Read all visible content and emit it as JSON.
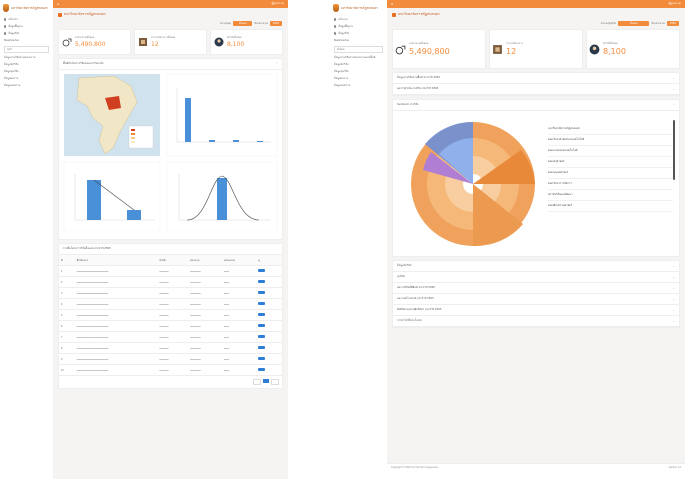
{
  "screens": {
    "left": {
      "sidebar": {
        "brand": "มหาวิทยาลัยราชภัฏสกลนคร",
        "items": [
          "หน้าแรก",
          "ข้อมูลพื้นฐาน",
          "ข้อมูลวิจัย"
        ],
        "filter_label": "ปีงบประมาณ",
        "filter_value": "ทุกปี",
        "menu": [
          "ข้อมูลงานวิจัยตามหน่วยงาน",
          "ข้อมูลนักวิจัย",
          "ข้อมูลทุนวิจัย",
          "ข้อมูลผลงาน",
          "ข้อมูลบทความ"
        ]
      },
      "topbar": {
        "user": "ผู้ดูแลระบบ"
      },
      "page_title": "มหาวิทยาลัยราชภัฏสกลนคร",
      "filters": {
        "label_1": "ประเภททุน",
        "value_1": "ทั้งหมด",
        "label_2": "ปีงบประมาณ",
        "value_2": "2565"
      },
      "stats": [
        {
          "icon": "money-icon",
          "label": "งบประมาณทั้งหมด",
          "value": "5,490,800"
        },
        {
          "icon": "map-icon",
          "label": "จำนวนโครงการทั้งหมด",
          "value": "12"
        },
        {
          "icon": "avatar-icon",
          "label": "นักวิจัยทั้งหมด",
          "value": "8,100"
        }
      ],
      "map_panel_title": "พื้นที่ดำเนินการวิจัยของมหาวิทยาลัย",
      "table_title": "รายชื่อโครงการวิจัยทั้งหมด ประจำปี 2565",
      "table_columns": [
        "#",
        "ชื่อโครงการ",
        "หัวหน้า",
        "หน่วยงาน",
        "งบประมาณ",
        "ดู"
      ]
    },
    "right": {
      "sidebar": {
        "brand": "มหาวิทยาลัยราชภัฏสกลนคร",
        "items": [
          "หน้าแรก",
          "ข้อมูลพื้นฐาน",
          "ข้อมูลวิจัย"
        ],
        "filter_label": "ปีงบประมาณ",
        "filter_value": "ทั้งหมด",
        "menu": [
          "ข้อมูลงานวิจัยตามหน่วยงานและพื้นที่",
          "ข้อมูลนักวิจัย",
          "ข้อมูลทุนวิจัย",
          "ข้อมูลผลงาน",
          "ข้อมูลบทความ"
        ]
      },
      "topbar": {
        "user": "ผู้ดูแลระบบ"
      },
      "page_title": "มหาวิทยาลัยราชภัฏสกลนคร",
      "filters": {
        "label_1": "ประเภททุนวิจัย",
        "value_1": "ทั้งหมด",
        "label_2": "ปีงบประมาณ",
        "value_2": "2565"
      },
      "stats": [
        {
          "icon": "money-icon",
          "label": "งบประมาณทั้งหมด",
          "value": "5,490,800"
        },
        {
          "icon": "map-icon",
          "label": "จำนวนโครงการ",
          "value": "12"
        },
        {
          "icon": "avatar-icon",
          "label": "นักวิจัยทั้งหมด",
          "value": "8,100"
        }
      ],
      "accordions_top": [
        "ข้อมูลงานวิจัยตามพื้นที่ ประจำปี 2565",
        "ผลการดำเนินงานวิจัย ประจำปี 2565"
      ],
      "sunburst_title": "Sunburst งานวิจัย",
      "legend": [
        "มหาวิทยาลัยราชภัฏสกลนคร",
        "คณะวิทยาศาสตร์และเทคโนโลยี",
        "คณะเกษตรและเทคโนโลยี",
        "คณะครุศาสตร์",
        "คณะมนุษยศาสตร์",
        "คณะวิทยาการจัดการ",
        "สถาบันวิจัยและพัฒนา",
        "คณะศิลปกรรมศาสตร์"
      ],
      "accordions_bottom": [
        "ข้อมูลนักวิจัย",
        "ทุนวิจัย",
        "ผลงานวิจัยที่ตีพิมพ์ ประจำปี 2565",
        "ผลงานสร้างสรรค์ ประจำปี 2565",
        "สิทธิบัตรและอนุสิทธิบัตร ประจำปี 2565",
        "การนำไปใช้ประโยชน์"
      ],
      "footer": {
        "left": "Copyright © 2022 มหาวิทยาลัยราชภัฏสกลนคร",
        "right": "Version 1.0"
      }
    }
  },
  "colors": {
    "accent": "#f28c3c",
    "dark_accent": "#c2571a",
    "blue": "#4a90d9"
  }
}
